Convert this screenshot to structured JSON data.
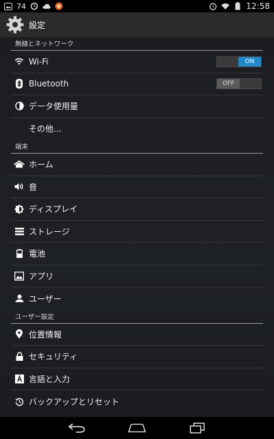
{
  "status_bar": {
    "notification_count": "74",
    "time": "12:58",
    "left_icons": [
      "image-icon",
      "count",
      "sync-icon",
      "cloud-icon",
      "app-icon"
    ],
    "right_icons": [
      "alarm-icon",
      "wifi-icon",
      "battery-icon"
    ]
  },
  "action_bar": {
    "title": "設定",
    "icon": "gear-icon"
  },
  "sections": {
    "wireless": {
      "header": "無線とネットワーク",
      "items": {
        "wifi": {
          "label": "Wi-Fi",
          "icon": "wifi-icon",
          "toggle": "ON"
        },
        "bluetooth": {
          "label": "Bluetooth",
          "icon": "bluetooth-icon",
          "toggle": "OFF"
        },
        "data_usage": {
          "label": "データ使用量",
          "icon": "data-usage-icon"
        },
        "more": {
          "label": "その他..."
        }
      }
    },
    "device": {
      "header": "端末",
      "items": {
        "home": {
          "label": "ホーム",
          "icon": "home-icon"
        },
        "sound": {
          "label": "音",
          "icon": "speaker-icon"
        },
        "display": {
          "label": "ディスプレイ",
          "icon": "brightness-icon"
        },
        "storage": {
          "label": "ストレージ",
          "icon": "storage-icon"
        },
        "battery": {
          "label": "電池",
          "icon": "battery-icon"
        },
        "apps": {
          "label": "アプリ",
          "icon": "apps-icon"
        },
        "users": {
          "label": "ユーザー",
          "icon": "user-icon"
        }
      }
    },
    "personal": {
      "header": "ユーザー設定",
      "items": {
        "location": {
          "label": "位置情報",
          "icon": "location-icon"
        },
        "security": {
          "label": "セキュリティ",
          "icon": "lock-icon"
        },
        "language": {
          "label": "言語と入力",
          "icon": "language-icon"
        },
        "backup": {
          "label": "バックアップとリセット",
          "icon": "backup-icon"
        }
      }
    }
  },
  "nav_bar": {
    "buttons": [
      "back-icon",
      "home-icon",
      "recents-icon"
    ]
  },
  "colors": {
    "toggle_on": "#1e88c8",
    "action_bar_bg": "#2b2b2b",
    "content_bg": "#1e2125"
  }
}
